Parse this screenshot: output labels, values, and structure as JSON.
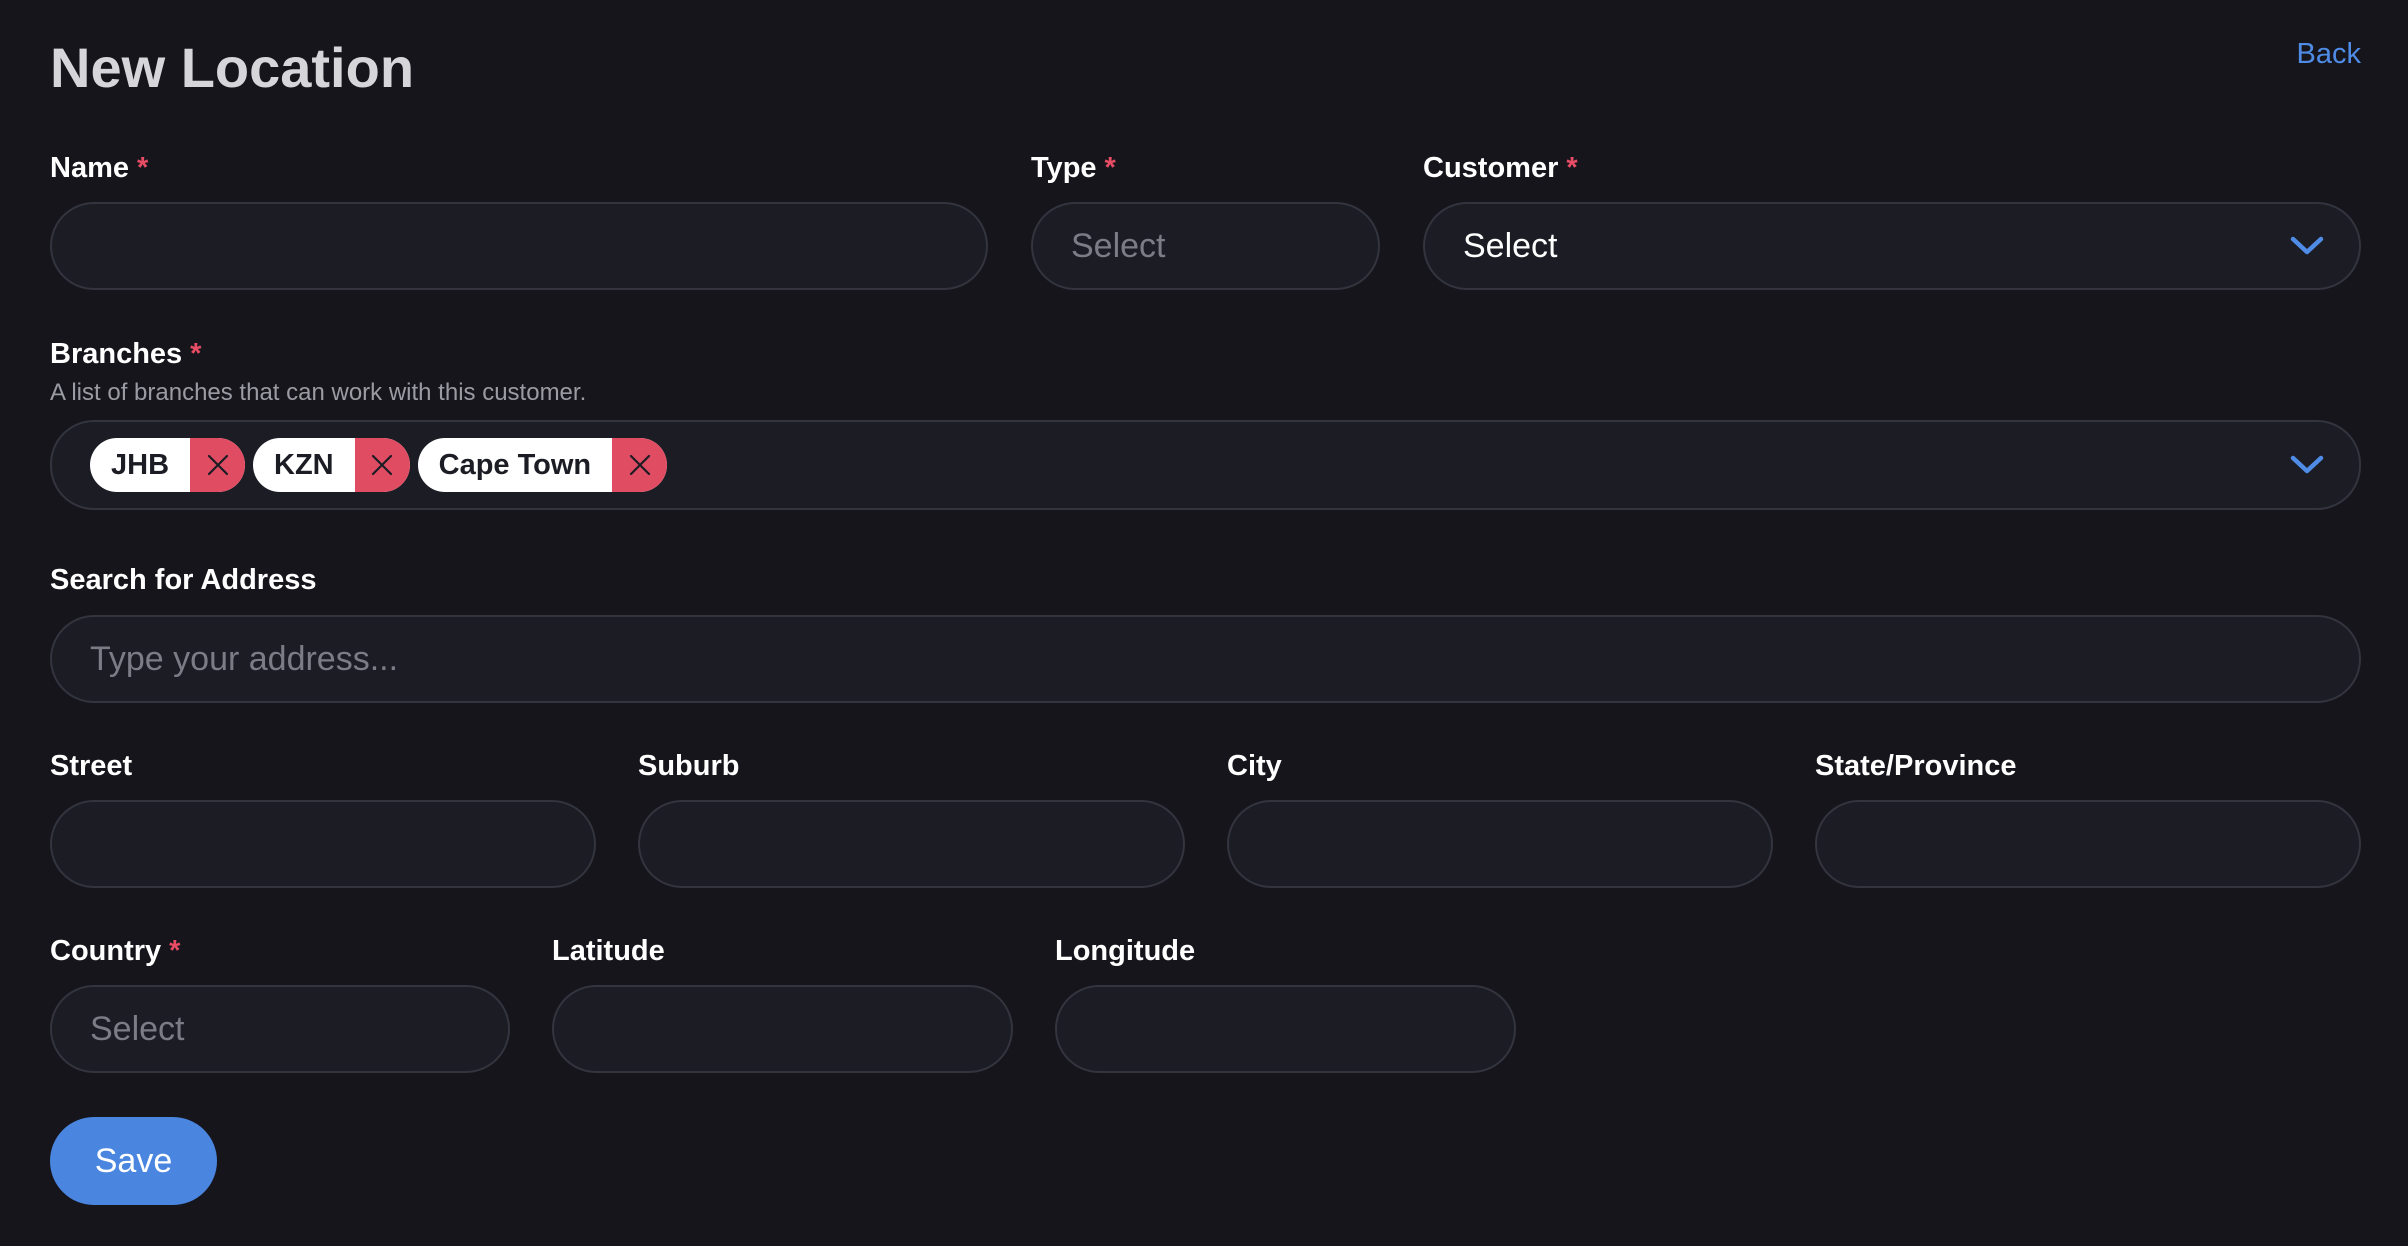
{
  "page": {
    "title": "New Location",
    "back_label": "Back"
  },
  "form": {
    "required_marker": "*",
    "name": {
      "label": "Name",
      "value": ""
    },
    "type": {
      "label": "Type",
      "placeholder": "Select"
    },
    "customer": {
      "label": "Customer",
      "value": "Select"
    },
    "branches": {
      "label": "Branches",
      "hint": "A list of branches that can work with this customer.",
      "tags": [
        "JHB",
        "KZN",
        "Cape Town"
      ]
    },
    "address_search": {
      "label": "Search for Address",
      "placeholder": "Type your address..."
    },
    "street": {
      "label": "Street",
      "value": ""
    },
    "suburb": {
      "label": "Suburb",
      "value": ""
    },
    "city": {
      "label": "City",
      "value": ""
    },
    "state": {
      "label": "State/Province",
      "value": ""
    },
    "country": {
      "label": "Country",
      "placeholder": "Select"
    },
    "latitude": {
      "label": "Latitude",
      "value": ""
    },
    "longitude": {
      "label": "Longitude",
      "value": ""
    },
    "save_label": "Save"
  },
  "icons": {
    "dropdown": "chevron-down-icon",
    "remove_tag": "close-icon"
  },
  "colors": {
    "background": "#16151c",
    "input_bg": "#1b1c24",
    "accent": "#4a86e0",
    "required": "#e84d65",
    "tag_remove": "#e04d63"
  }
}
